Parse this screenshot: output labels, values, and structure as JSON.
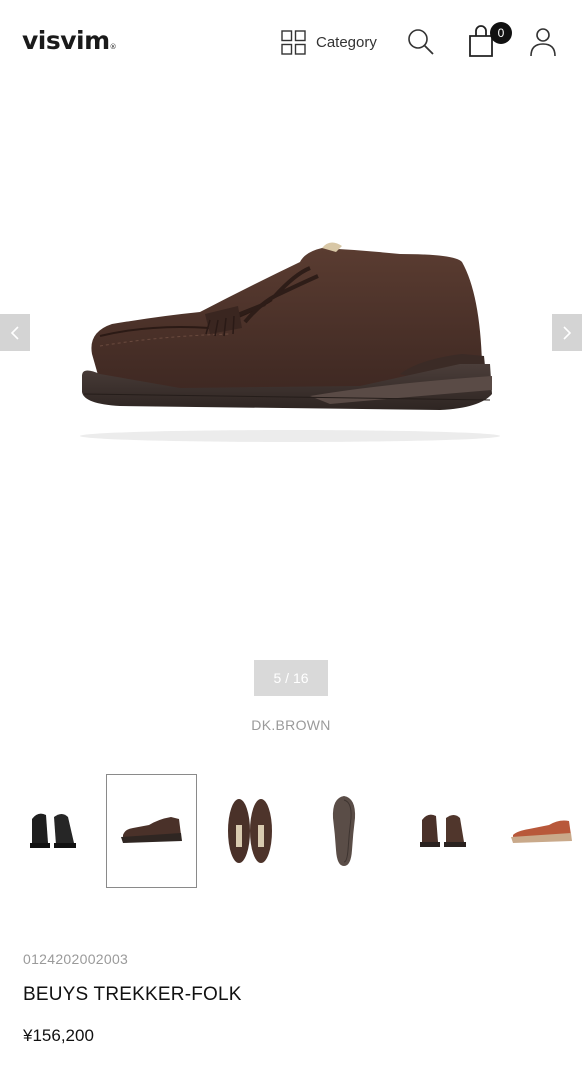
{
  "header": {
    "logo": "visvim",
    "logo_mark": "®",
    "category_label": "Category",
    "cart_count": "0"
  },
  "gallery": {
    "counter": "5 / 16",
    "color": "DK.BROWN",
    "current_index": 5,
    "total": 16,
    "thumbnails": [
      {
        "alt": "black pair back view"
      },
      {
        "alt": "dk brown side view"
      },
      {
        "alt": "dk brown top view"
      },
      {
        "alt": "sole view"
      },
      {
        "alt": "dk brown pair back view"
      },
      {
        "alt": "tan side view"
      }
    ]
  },
  "product": {
    "sku": "0124202002003",
    "name": "BEUYS TREKKER-FOLK",
    "price": "¥156,200"
  },
  "colors": {
    "suede_brown": "#4a3129",
    "sole_dark": "#3b302c",
    "tan": "#b8583a"
  }
}
